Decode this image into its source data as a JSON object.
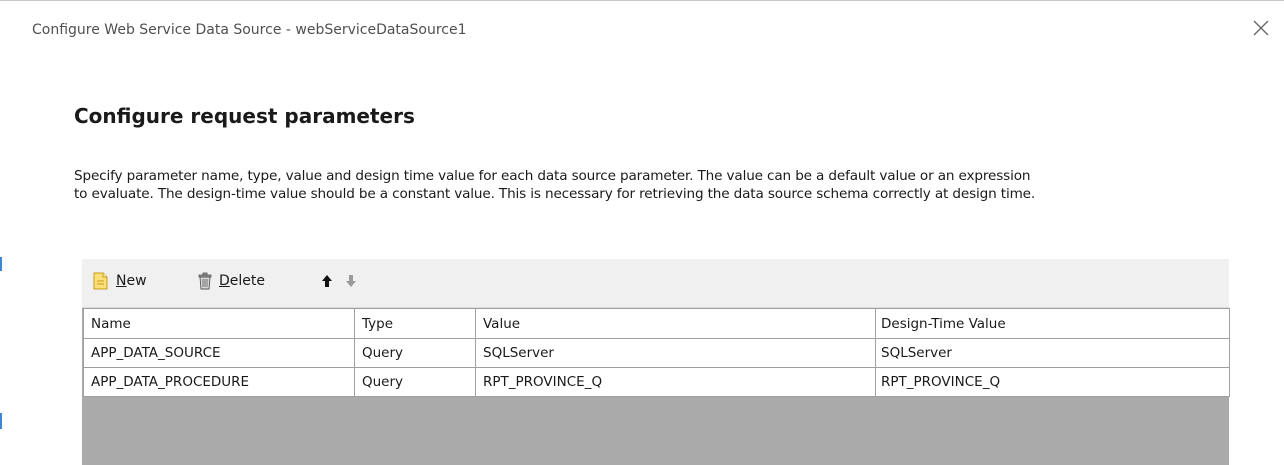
{
  "window": {
    "title": "Configure Web Service Data Source - webServiceDataSource1"
  },
  "page": {
    "heading": "Configure request parameters",
    "description_line1": "Specify parameter name, type, value and design time value for each data source parameter. The value can be a default value or an expression",
    "description_line2": "to evaluate. The design-time value should be a constant value. This is necessary for retrieving the data source schema correctly at design time."
  },
  "toolbar": {
    "new_key": "N",
    "new_rest": "ew",
    "delete_key": "D",
    "delete_rest": "elete",
    "icons": [
      "new-document-icon",
      "delete-bin-icon",
      "arrow-up-icon",
      "arrow-down-icon"
    ]
  },
  "table": {
    "columns": [
      "Name",
      "Type",
      "Value",
      "Design-Time Value"
    ],
    "rows": [
      [
        "APP_DATA_SOURCE",
        "Query",
        "SQLServer",
        "SQLServer"
      ],
      [
        "APP_DATA_PROCEDURE",
        "Query",
        "RPT_PROVINCE_Q",
        "RPT_PROVINCE_Q"
      ]
    ]
  },
  "colors": {
    "grid_empty": "#aaaaaa",
    "toolbar_bg": "#f0f0f0",
    "accent_edge": "#3c88d6"
  }
}
